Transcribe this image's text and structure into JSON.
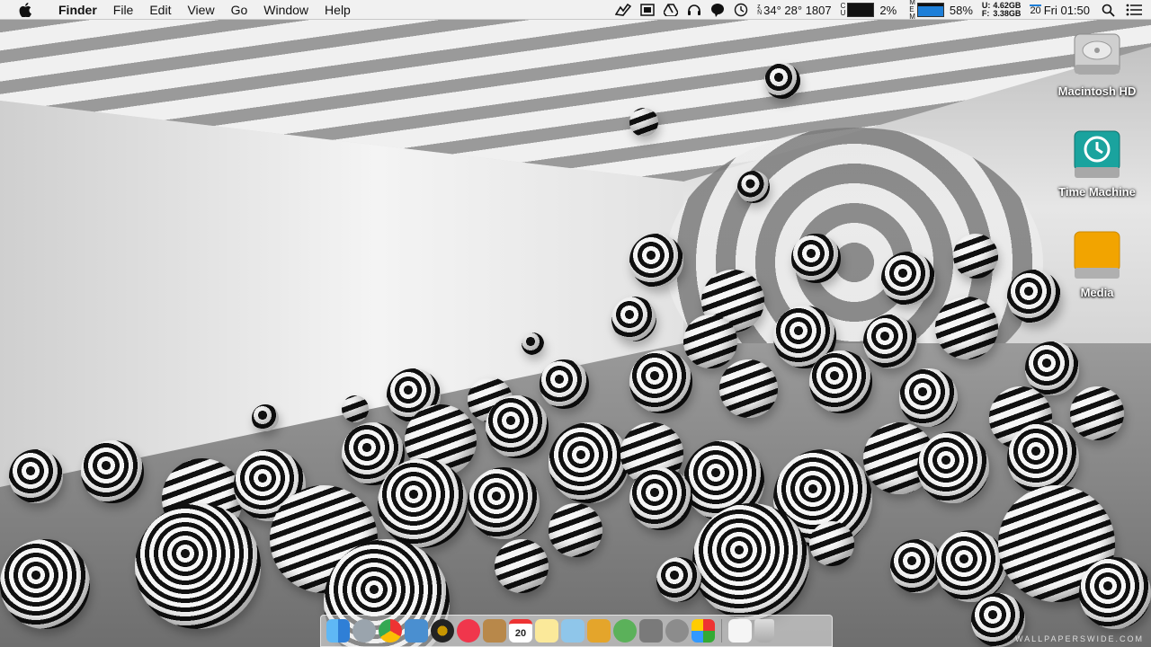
{
  "menubar": {
    "apple_icon": "apple-icon",
    "app_name": "Finder",
    "menus": [
      "File",
      "Edit",
      "View",
      "Go",
      "Window",
      "Help"
    ],
    "status": {
      "weather": "34° 28° 1807",
      "cpu_label_top": "C",
      "cpu_label_bottom": "U",
      "cpu_percent": "2%",
      "mem_label_top": "M",
      "mem_label_mid": "E",
      "mem_label_bottom": "M",
      "mem_percent": "58%",
      "disk_u_label": "U:",
      "disk_f_label": "F:",
      "disk_used": "4.62GB",
      "disk_free": "3.38GB",
      "calendar_day": "20",
      "clock": "Fri 01:50"
    }
  },
  "desktop_icons": [
    {
      "label": "Macintosh HD",
      "icon": "hard-drive-icon"
    },
    {
      "label": "Time Machine",
      "icon": "time-machine-icon"
    },
    {
      "label": "Media",
      "icon": "external-drive-icon"
    }
  ],
  "dock": {
    "calendar_day": "20",
    "items": [
      "finder",
      "launchpad",
      "chrome",
      "preview",
      "dvd-player",
      "itunes",
      "notefile",
      "calendar",
      "notes",
      "photo",
      "pineapple",
      "utorrent",
      "activity",
      "system-preferences",
      "unknown",
      "trash"
    ]
  },
  "watermark": "WALLPAPERSWIDE.COM",
  "colors": {
    "menubar": "#f1f1f1",
    "mem_bar": "#1e7fd8",
    "time_machine": "#1aa39e",
    "media_drive": "#f2a400"
  }
}
